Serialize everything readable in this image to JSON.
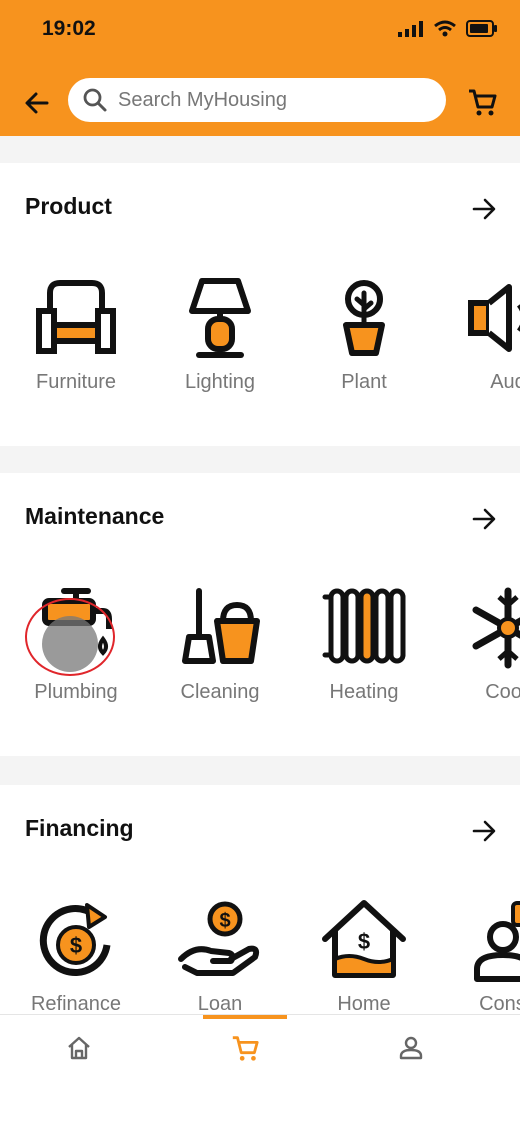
{
  "status_bar": {
    "time": "19:02"
  },
  "search": {
    "placeholder": "Search MyHousing"
  },
  "sections": [
    {
      "title": "Product",
      "items": [
        {
          "label": "Furniture",
          "icon": "armchair-icon"
        },
        {
          "label": "Lighting",
          "icon": "lamp-icon"
        },
        {
          "label": "Plant",
          "icon": "potted-plant-icon"
        },
        {
          "label": "Aud",
          "icon": "speaker-icon"
        }
      ]
    },
    {
      "title": "Maintenance",
      "items": [
        {
          "label": "Plumbing",
          "icon": "faucet-icon"
        },
        {
          "label": "Cleaning",
          "icon": "broom-bucket-icon"
        },
        {
          "label": "Heating",
          "icon": "radiator-icon"
        },
        {
          "label": "Cooli",
          "icon": "snowflake-icon"
        }
      ]
    },
    {
      "title": "Financing",
      "items": [
        {
          "label": "Refinance",
          "icon": "refinance-icon"
        },
        {
          "label": "Loan",
          "icon": "hand-coin-icon"
        },
        {
          "label": "Home",
          "icon": "house-dollar-icon"
        },
        {
          "label": "Consu",
          "icon": "consultant-icon"
        }
      ]
    }
  ],
  "bottom_nav": {
    "items": [
      {
        "name": "home",
        "icon": "home-icon"
      },
      {
        "name": "cart",
        "icon": "cart-icon",
        "active": true
      },
      {
        "name": "profile",
        "icon": "person-icon"
      }
    ]
  },
  "colors": {
    "accent": "#f7931e",
    "text": "#111111",
    "muted": "#777777",
    "tap_ring": "#e0262b"
  }
}
